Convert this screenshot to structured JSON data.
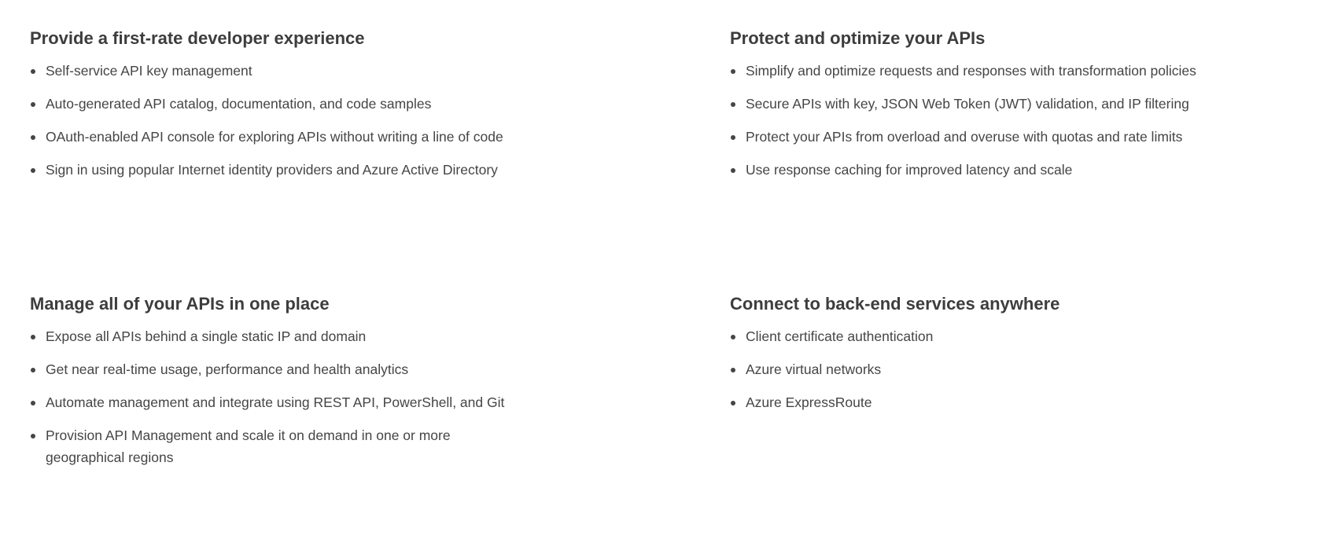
{
  "sections": [
    {
      "title": "Provide a first-rate developer experience",
      "items": [
        "Self-service API key management",
        "Auto-generated API catalog, documentation, and code samples",
        "OAuth-enabled API console for exploring APIs without writing a line of code",
        "Sign in using popular Internet identity providers and Azure Active Directory"
      ]
    },
    {
      "title": "Protect and optimize your APIs",
      "items": [
        "Simplify and optimize requests and responses with transformation policies",
        "Secure APIs with key, JSON Web Token (JWT) validation, and IP filtering",
        "Protect your APIs from overload and overuse with quotas and rate limits",
        "Use response caching for improved latency and scale"
      ]
    },
    {
      "title": "Manage all of your APIs in one place",
      "items": [
        "Expose all APIs behind a single static IP and domain",
        "Get near real-time usage, performance and health analytics",
        "Automate management and integrate using REST API, PowerShell, and Git",
        "Provision API Management and scale it on demand in one or more geographical regions"
      ]
    },
    {
      "title": "Connect to back-end services anywhere",
      "items": [
        "Client certificate authentication",
        "Azure virtual networks",
        "Azure ExpressRoute"
      ]
    }
  ]
}
